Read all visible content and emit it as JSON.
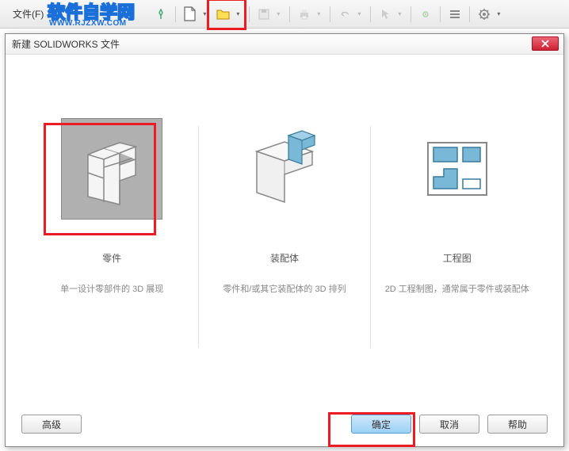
{
  "toolbar": {
    "file_menu": "文件(F)"
  },
  "watermark": {
    "title": "软件自学网",
    "url": "WWW.RJZXW.COM"
  },
  "dialog": {
    "title": "新建 SOLIDWORKS 文件",
    "options": [
      {
        "title": "零件",
        "desc": "单一设计零部件的 3D 展现"
      },
      {
        "title": "装配体",
        "desc": "零件和/或其它装配体的 3D 排列"
      },
      {
        "title": "工程图",
        "desc": "2D 工程制图，通常属于零件或装配体"
      }
    ],
    "buttons": {
      "advanced": "高级",
      "ok": "确定",
      "cancel": "取消",
      "help": "帮助"
    }
  }
}
